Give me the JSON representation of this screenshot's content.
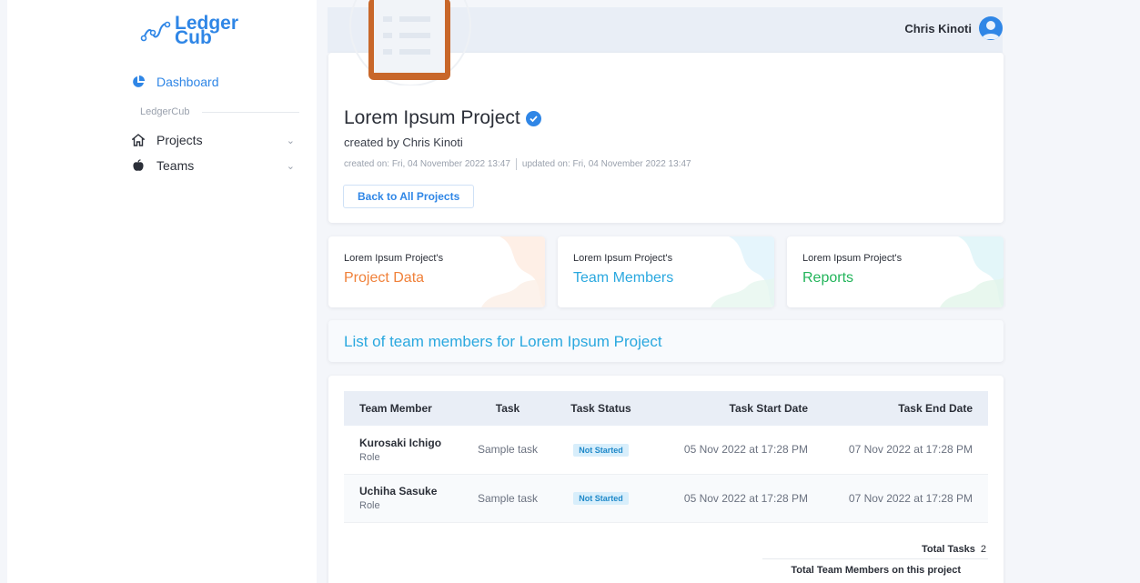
{
  "logo": {
    "line1": "Ledger",
    "line2": "Cub"
  },
  "sidebar": {
    "dashboard": "Dashboard",
    "section": "LedgerCub",
    "items": [
      {
        "label": "Projects",
        "icon": "home-icon"
      },
      {
        "label": "Teams",
        "icon": "apple-icon"
      }
    ]
  },
  "topbar": {
    "user_name": "Chris Kinoti"
  },
  "project": {
    "title": "Lorem Ipsum Project",
    "created_by": "created by Chris Kinoti",
    "created_on": "created on: Fri, 04 November 2022 13:47",
    "updated_on": "updated on: Fri, 04 November 2022 13:47",
    "back_label": "Back to All Projects"
  },
  "stats": [
    {
      "prefix": "Lorem Ipsum Project's",
      "label": "Project Data",
      "color": "#f0813a"
    },
    {
      "prefix": "Lorem Ipsum Project's",
      "label": "Team Members",
      "color": "#2aa8df"
    },
    {
      "prefix": "Lorem Ipsum Project's",
      "label": "Reports",
      "color": "#22b45a"
    }
  ],
  "list_title": "List of team members for Lorem Ipsum Project",
  "table": {
    "headers": [
      "Team Member",
      "Task",
      "Task Status",
      "Task Start Date",
      "Task End Date"
    ],
    "rows": [
      {
        "name": "Kurosaki Ichigo",
        "role": "Role",
        "task": "Sample task",
        "status": "Not Started",
        "start": "05 Nov 2022 at 17:28 PM",
        "end": "07 Nov 2022 at 17:28 PM"
      },
      {
        "name": "Uchiha Sasuke",
        "role": "Role",
        "task": "Sample task",
        "status": "Not Started",
        "start": "05 Nov 2022 at 17:28 PM",
        "end": "07 Nov 2022 at 17:28 PM"
      }
    ]
  },
  "totals": {
    "tasks_label": "Total Tasks",
    "tasks_value": "2",
    "members_label": "Total Team Members on this project"
  },
  "colors": {
    "accent": "#2f86e6",
    "cyan": "#2aa8df",
    "orange": "#f0813a",
    "green": "#22b45a"
  }
}
